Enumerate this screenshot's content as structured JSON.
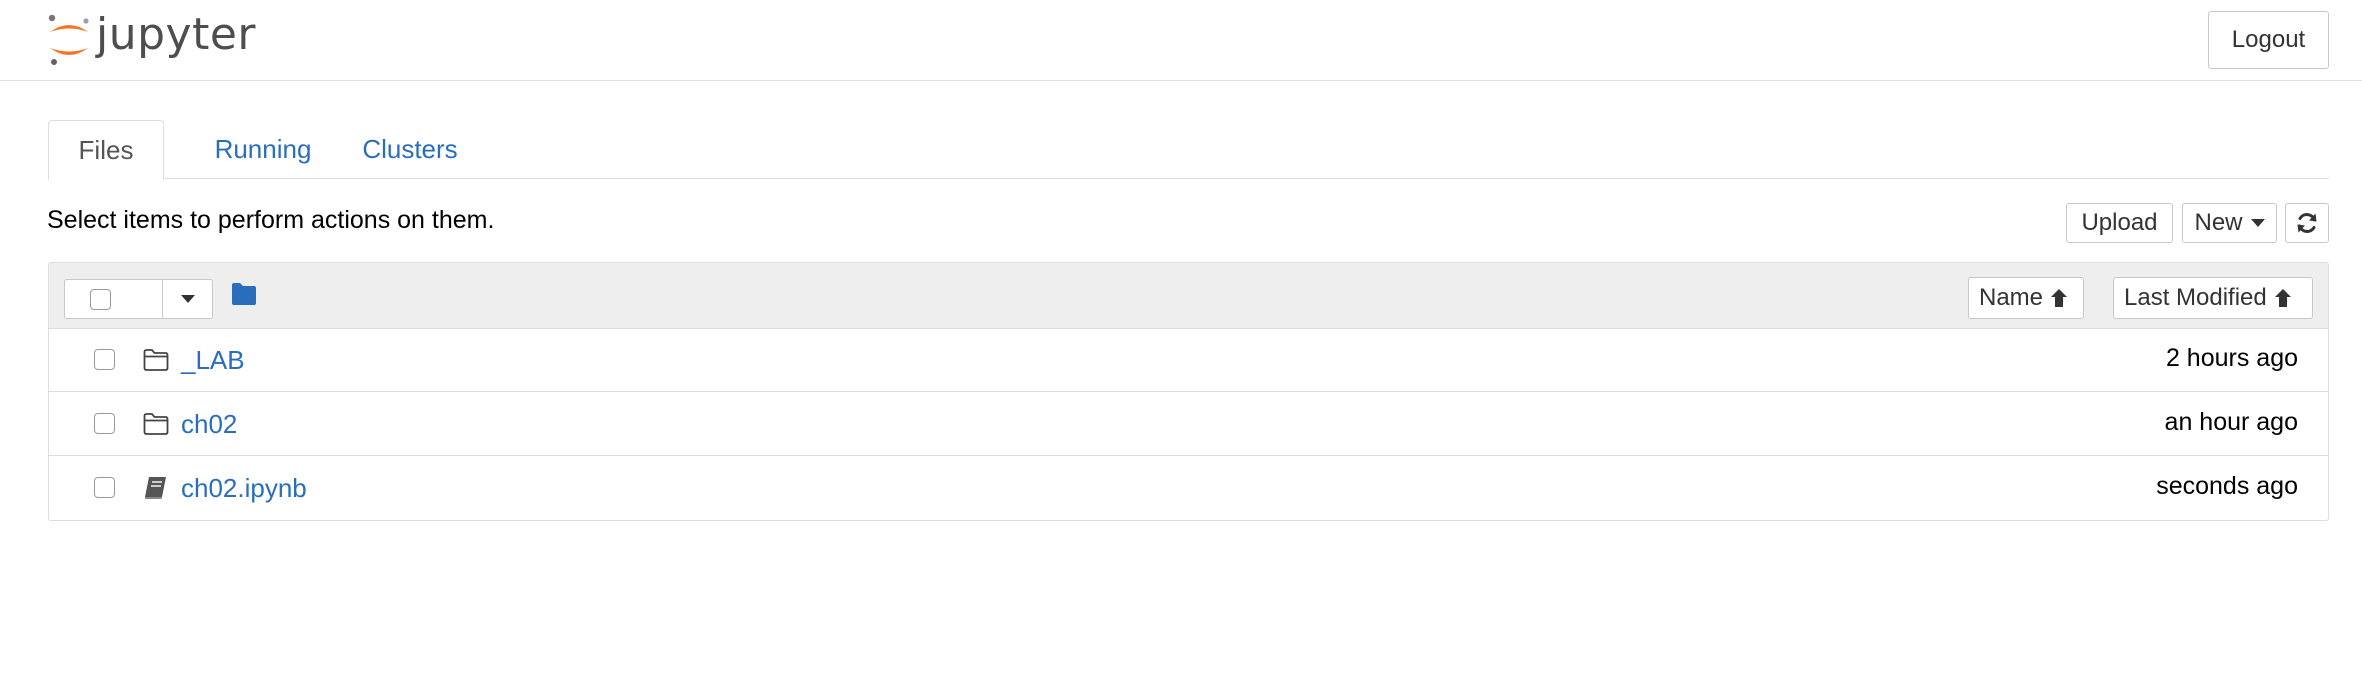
{
  "header": {
    "logo_text": "jupyter",
    "logout_label": "Logout"
  },
  "tabs": [
    {
      "label": "Files",
      "active": true
    },
    {
      "label": "Running",
      "active": false
    },
    {
      "label": "Clusters",
      "active": false
    }
  ],
  "toolbar": {
    "message": "Select items to perform actions on them.",
    "upload_label": "Upload",
    "new_label": "New",
    "refresh_icon": "refresh-icon"
  },
  "list_header": {
    "name_sort_label": "Name",
    "modified_sort_label": "Last Modified"
  },
  "files": [
    {
      "name": "_LAB",
      "type": "folder",
      "icon": "folder-outline-icon",
      "modified": "2 hours ago"
    },
    {
      "name": "ch02",
      "type": "folder",
      "icon": "folder-outline-icon",
      "modified": "an hour ago"
    },
    {
      "name": "ch02.ipynb",
      "type": "notebook",
      "icon": "notebook-icon",
      "modified": "seconds ago"
    }
  ],
  "colors": {
    "link": "#2a6ebb",
    "brand_orange": "#f37626",
    "header_bg": "#eeeeee"
  }
}
